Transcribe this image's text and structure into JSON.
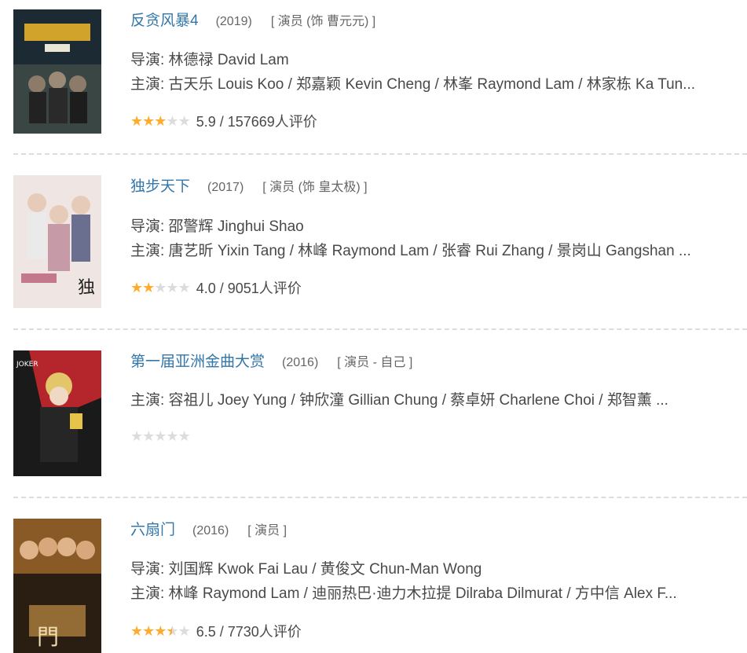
{
  "items": [
    {
      "title": "反贪风暴4",
      "year": "(2019)",
      "role": "[ 演员 (饰 曹元元) ]",
      "director": "导演: 林德禄 David Lam",
      "cast": "主演: 古天乐 Louis Koo / 郑嘉颖 Kevin Cheng / 林峯 Raymond Lam / 林家栋 Ka Tun...",
      "stars": 3,
      "rating": "5.9 / 157669人评价",
      "poster_colors": [
        "#1c2a33",
        "#4d5b57",
        "#d2a32a"
      ]
    },
    {
      "title": "独步天下",
      "year": "(2017)",
      "role": "[ 演员 (饰 皇太极) ]",
      "director": "导演: 邵警辉 Jinghui Shao",
      "cast": "主演: 唐艺昕 Yixin Tang / 林峰 Raymond Lam / 张睿 Rui Zhang / 景岗山 Gangshan ...",
      "stars": 2,
      "rating": "4.0 / 9051人评价",
      "poster_colors": [
        "#efe6e4",
        "#c69aa6",
        "#6a6f8f"
      ]
    },
    {
      "title": "第一届亚洲金曲大赏",
      "year": "(2016)",
      "role": "[ 演员 - 自己 ]",
      "director": "",
      "cast": "主演: 容祖儿 Joey Yung / 钟欣潼 Gillian Chung / 蔡卓妍 Charlene Choi / 郑智薰 ...",
      "stars": 0,
      "rating": "",
      "poster_colors": [
        "#1a1a1a",
        "#b4262b",
        "#e3c56a"
      ]
    },
    {
      "title": "六扇门",
      "year": "(2016)",
      "role": "[ 演员 ]",
      "director": "导演: 刘国辉 Kwok Fai Lau / 黄俊文 Chun-Man Wong",
      "cast": "主演: 林峰 Raymond Lam / 迪丽热巴·迪力木拉提 Dilraba Dilmurat / 方中信 Alex F...",
      "stars": 3.5,
      "rating": "6.5 / 7730人评价",
      "poster_colors": [
        "#2a1d12",
        "#8a5a26",
        "#d9a24b"
      ]
    }
  ],
  "icons": {
    "star": "star-icon"
  },
  "colors": {
    "link": "#3377aa",
    "star_on": "#ffac2d",
    "star_off": "#dcdcdc"
  }
}
